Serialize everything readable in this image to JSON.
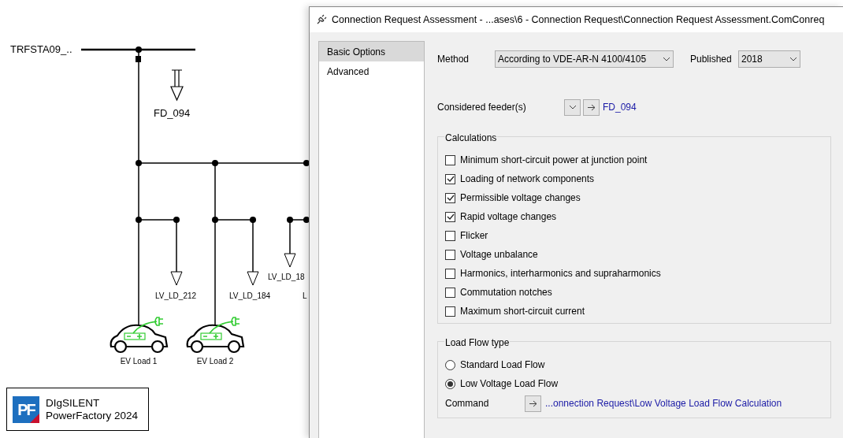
{
  "diagram": {
    "busbar_label": "TRFSTA09_..",
    "feeder_label": "FD_094",
    "loads": [
      {
        "label": "LV_LD_212"
      },
      {
        "label": "LV_LD_184"
      },
      {
        "label": "LV_LD_18"
      },
      {
        "label": "L"
      }
    ],
    "ev_loads": [
      {
        "label": "EV Load 1"
      },
      {
        "label": "EV Load 2"
      }
    ],
    "logo": {
      "badge": "PF",
      "line1": "DIgSILENT",
      "line2": "PowerFactory 2024"
    }
  },
  "dialog": {
    "title": "Connection Request Assessment - ...ases\\6 - Connection Request\\Connection Request Assessment.ComConreq",
    "nav": [
      {
        "label": "Basic Options",
        "selected": true
      },
      {
        "label": "Advanced",
        "selected": false
      }
    ],
    "method": {
      "label": "Method",
      "value": "According to VDE-AR-N 4100/4105"
    },
    "published": {
      "label": "Published",
      "value": "2018"
    },
    "feeders": {
      "label": "Considered feeder(s)",
      "value": "FD_094"
    },
    "calculations": {
      "title": "Calculations",
      "items": [
        {
          "label": "Minimum short-circuit power at junction point",
          "checked": false
        },
        {
          "label": "Loading of network components",
          "checked": true
        },
        {
          "label": "Permissible voltage changes",
          "checked": true
        },
        {
          "label": "Rapid voltage changes",
          "checked": true
        },
        {
          "label": "Flicker",
          "checked": false
        },
        {
          "label": "Voltage unbalance",
          "checked": false
        },
        {
          "label": "Harmonics, interharmonics and supraharmonics",
          "checked": false
        },
        {
          "label": "Commutation notches",
          "checked": false
        },
        {
          "label": "Maximum short-circuit current",
          "checked": false
        }
      ]
    },
    "load_flow": {
      "title": "Load Flow type",
      "options": [
        {
          "label": "Standard Load Flow",
          "selected": false
        },
        {
          "label": "Low Voltage Load Flow",
          "selected": true
        }
      ],
      "command": {
        "label": "Command",
        "value": "...onnection Request\\Low Voltage Load Flow Calculation"
      }
    }
  }
}
